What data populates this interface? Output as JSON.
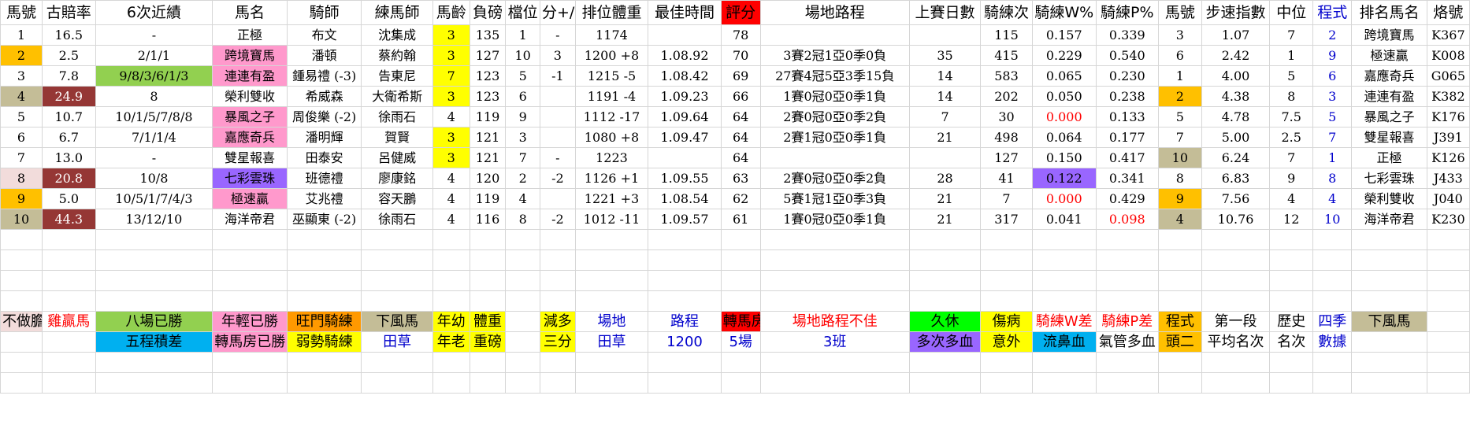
{
  "colors": {
    "gold": "#ffc000",
    "tan": "#c4bd97",
    "maroon": "#953735",
    "pink": "#ff99cc",
    "yellow": "#ffff00",
    "green": "#92d050",
    "purple": "#9966ff",
    "blue_fill": "#00b0f0",
    "orange": "#ff9900",
    "bright_green": "#00ff00",
    "red": "#ff0000",
    "light_pink": "#f2dcdb"
  },
  "headers": [
    "馬號",
    "古賠率",
    "6次近績",
    "馬名",
    "騎師",
    "練馬師",
    "馬齡",
    "負磅",
    "檔位",
    "分+/-",
    "排位體重",
    "最佳時間",
    "評分",
    "場地路程",
    "上賽日數",
    "騎練次",
    "騎練W%",
    "騎練P%",
    "馬號",
    "步速指數",
    "中位",
    "程式",
    "排名馬名",
    "烙號"
  ],
  "rows": [
    [
      "1",
      "16.5",
      "-",
      "正極",
      "布文",
      "沈集成",
      "3",
      "135",
      "1",
      "-",
      "1174",
      "",
      "78",
      "",
      "",
      "115",
      "0.157",
      "0.339",
      "3",
      "1.07",
      "7",
      "2",
      "跨境寶馬",
      "K367"
    ],
    [
      "2",
      "2.5",
      "2/1/1",
      "跨境寶馬",
      "潘頓",
      "蔡約翰",
      "3",
      "127",
      "10",
      "3",
      "1200 +8",
      "1.08.92",
      "70",
      "3賽2冠1亞0季0負",
      "35",
      "415",
      "0.229",
      "0.540",
      "6",
      "2.42",
      "1",
      "9",
      "極速贏",
      "K008"
    ],
    [
      "3",
      "7.8",
      "9/8/3/6/1/3",
      "連連有盈",
      "鍾易禮 (-3)",
      "告東尼",
      "7",
      "123",
      "5",
      "-1",
      "1215 -5",
      "1.08.42",
      "69",
      "27賽4冠5亞3季15負",
      "14",
      "583",
      "0.065",
      "0.230",
      "1",
      "4.00",
      "5",
      "6",
      "嘉應奇兵",
      "G065"
    ],
    [
      "4",
      "24.9",
      "8",
      "榮利雙收",
      "希威森",
      "大衛希斯",
      "3",
      "123",
      "6",
      "",
      "1191 -4",
      "1.09.23",
      "66",
      "1賽0冠0亞0季1負",
      "14",
      "202",
      "0.050",
      "0.238",
      "2",
      "4.38",
      "8",
      "3",
      "連連有盈",
      "K382"
    ],
    [
      "5",
      "10.7",
      "10/1/5/7/8/8",
      "暴風之子",
      "周俊樂 (-2)",
      "徐雨石",
      "4",
      "119",
      "9",
      "",
      "1112 -17",
      "1.09.64",
      "64",
      "2賽0冠0亞0季2負",
      "7",
      "30",
      "0.000",
      "0.133",
      "5",
      "4.78",
      "7.5",
      "5",
      "暴風之子",
      "K176"
    ],
    [
      "6",
      "6.7",
      "7/1/1/4",
      "嘉應奇兵",
      "潘明輝",
      "賀賢",
      "3",
      "121",
      "3",
      "",
      "1080 +8",
      "1.09.47",
      "64",
      "2賽1冠0亞0季1負",
      "21",
      "498",
      "0.064",
      "0.177",
      "7",
      "5.00",
      "2.5",
      "7",
      "雙星報喜",
      "J391"
    ],
    [
      "7",
      "13.0",
      "-",
      "雙星報喜",
      "田泰安",
      "呂健威",
      "3",
      "121",
      "7",
      "-",
      "1223",
      "",
      "64",
      "",
      "",
      "127",
      "0.150",
      "0.417",
      "10",
      "6.24",
      "7",
      "1",
      "正極",
      "K126"
    ],
    [
      "8",
      "20.8",
      "10/8",
      "七彩雲珠",
      "班德禮",
      "廖康銘",
      "4",
      "120",
      "2",
      "-2",
      "1126 +1",
      "1.09.55",
      "63",
      "2賽0冠0亞0季2負",
      "28",
      "41",
      "0.122",
      "0.341",
      "8",
      "6.83",
      "9",
      "8",
      "七彩雲珠",
      "J433"
    ],
    [
      "9",
      "5.0",
      "10/5/1/7/4/3",
      "極速贏",
      "艾兆禮",
      "容天鵬",
      "4",
      "119",
      "4",
      "",
      "1221 +3",
      "1.08.54",
      "62",
      "5賽1冠1亞0季3負",
      "21",
      "7",
      "0.000",
      "0.429",
      "9",
      "7.56",
      "4",
      "4",
      "榮利雙收",
      "J040"
    ],
    [
      "10",
      "44.3",
      "13/12/10",
      "海洋帝君",
      "巫顯東 (-2)",
      "徐雨石",
      "4",
      "116",
      "8",
      "-2",
      "1012 -11",
      "1.09.57",
      "61",
      "1賽0冠0亞0季1負",
      "21",
      "317",
      "0.041",
      "0.098",
      "4",
      "10.76",
      "12",
      "10",
      "海洋帝君",
      "K230"
    ]
  ],
  "legend_row1": [
    "不做膽",
    "雞贏馬",
    "八場已勝",
    "年輕已勝",
    "旺門騎練",
    "下風馬",
    "年幼",
    "體重",
    "",
    "減多",
    "場地",
    "路程",
    "轉馬房",
    "場地路程不佳",
    "久休",
    "傷病",
    "騎練W差",
    "騎練P差",
    "程式",
    "第一段",
    "歷史",
    "四季",
    "下風馬",
    ""
  ],
  "legend_row2": [
    "",
    "",
    "五程積差",
    "轉馬房已勝",
    "弱勢騎練",
    "田草",
    "年老",
    "重磅",
    "",
    "三分",
    "田草",
    "1200",
    "5場",
    "3班",
    "多次多血",
    "意外",
    "流鼻血",
    "氣管多血",
    "頭二",
    "平均名次",
    "名次",
    "數據",
    "",
    ""
  ]
}
